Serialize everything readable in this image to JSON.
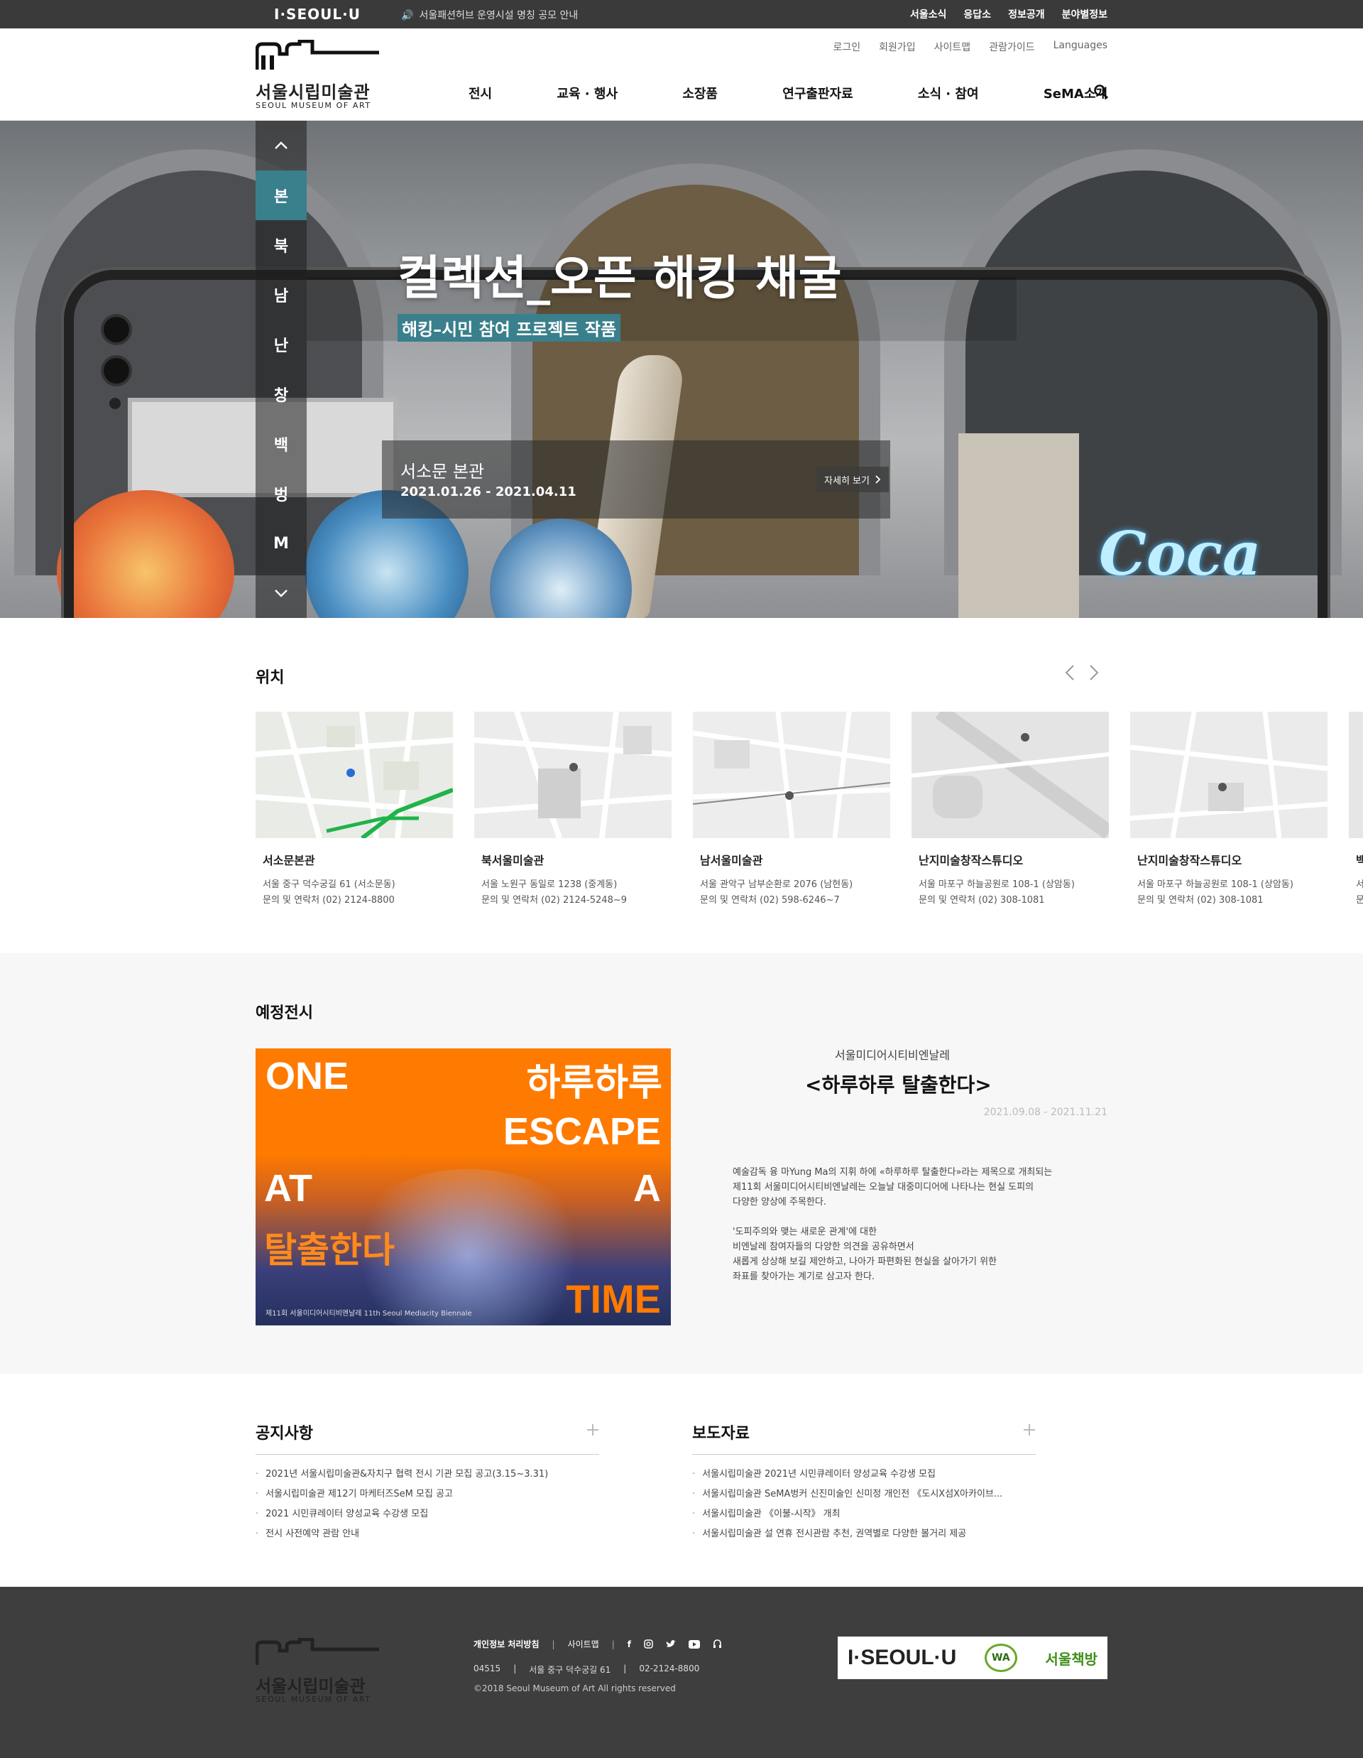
{
  "topbar": {
    "brand": "I·SEOUL·U",
    "notice": "서울패션허브 운영시설 명칭 공모 안내",
    "links": [
      "서울소식",
      "응답소",
      "정보공개",
      "분야별정보"
    ]
  },
  "header": {
    "logo_kr": "서울시립미술관",
    "logo_en": "SEOUL MUSEUM OF ART",
    "util_links": [
      "로그인",
      "회원가입",
      "사이트맵",
      "관람가이드",
      "Languages"
    ],
    "gnb": [
      "전시",
      "교육 · 행사",
      "소장품",
      "연구출판자료",
      "소식 · 참여",
      "SeMA소개"
    ]
  },
  "hero": {
    "side_nav": [
      "본",
      "북",
      "남",
      "난",
      "창",
      "백",
      "벙",
      "M"
    ],
    "active_index": 0,
    "title": "컬렉션_오픈 해킹 채굴",
    "subtitle": "해킹–시민 참여 프로젝트 작품",
    "place": "서소문 본관",
    "date": "2021.01.26 - 2021.04.11",
    "more_label": "자세히 보기",
    "sign_text": "Coca"
  },
  "location": {
    "title": "위치",
    "cards": [
      {
        "name": "서소문본관",
        "addr": "서울 중구 덕수궁길 61 (서소문동)",
        "tel": "문의 및 연락처 (02) 2124-8800"
      },
      {
        "name": "북서울미술관",
        "addr": "서울 노원구 동일로 1238 (중계동)",
        "tel": "문의 및 연락처 (02) 2124-5248~9"
      },
      {
        "name": "남서울미술관",
        "addr": "서울 관악구 남부순환로 2076 (남현동)",
        "tel": "문의 및 연락처 (02) 598-6246~7"
      },
      {
        "name": "난지미술창작스튜디오",
        "addr": "서울 마포구 하늘공원로 108-1 (상암동)",
        "tel": "문의 및 연락처 (02) 308-1081"
      },
      {
        "name": "난지미술창작스튜디오",
        "addr": "서울 마포구 하늘공원로 108-1 (상암동)",
        "tel": "문의 및 연락처 (02) 308-1081"
      },
      {
        "name": "백",
        "addr": "서",
        "tel": "문"
      }
    ]
  },
  "upcoming": {
    "title": "예정전시",
    "poster": {
      "w1": "ONE",
      "w2": "하루하루",
      "w3": "ESCAPE",
      "w4": "AT",
      "w5": "A",
      "w6": "탈출한다",
      "w7": "TIME",
      "small": "제11회 서울미디어시티비엔날레  11th Seoul Mediacity Biennale"
    },
    "subtitle": "서울미디어시티비엔날레",
    "exh_title": "<하루하루 탈출한다>",
    "date": "2021.09.08 - 2021.11.21",
    "desc1": [
      "예술감독 융 마Yung Ma의 지휘 하에 «하루하루 탈출한다»라는 제목으로 개최되는",
      "제11회 서울미디어시티비엔날레는 오늘날 대중미디어에 나타나는 현실 도피의",
      "다양한 양상에 주목한다."
    ],
    "desc2": [
      "'도피주의와 맺는 새로운 관계'에 대한",
      "비엔날레 참여자들의 다양한 의견을 공유하면서",
      "새롭게 상상해 보길 제안하고, 나아가 파편화된 현실을 살아가기 위한",
      "좌표를 찾아가는 계기로 삼고자 한다."
    ]
  },
  "notice": {
    "title": "공지사항",
    "items": [
      "2021년 서울시립미술관&자치구 협력 전시 기관 모집 공고(3.15~3.31)",
      "서울시립미술관 제12기 마케터즈SeM 모집 공고",
      "2021 시민큐레이터 양성교육 수강생 모집",
      "전시 사전예약 관람 안내"
    ]
  },
  "press": {
    "title": "보도자료",
    "items": [
      "서울시립미술관 2021년 시민큐레이터 양성교육 수강생 모집",
      "서울시립미술관 SeMA벙커 신진미술인 신미정 개인전 《도시X섬X아카이브...",
      "서울시립미술관 《이불-시작》 개최",
      "서울시립미술관 설 연휴 전시관람 추천, 권역별로 다양한 볼거리 제공"
    ]
  },
  "footer": {
    "privacy": "개인정보 처리방침",
    "sitemap": "사이트맵",
    "zip": "04515",
    "address": "서울 중구 덕수궁길 61",
    "phone": "02-2124-8800",
    "copyright": "©2018 Seoul Museum of Art All rights reserved",
    "badge_seoul": "I·SEOUL·U",
    "badge_wa": "WA",
    "badge_book": "서울책방"
  },
  "colors": {
    "accent": "#3a7f8c",
    "topbar": "#3a3a3a",
    "footer": "#3e3e3e",
    "poster_orange": "#ff7a00"
  }
}
